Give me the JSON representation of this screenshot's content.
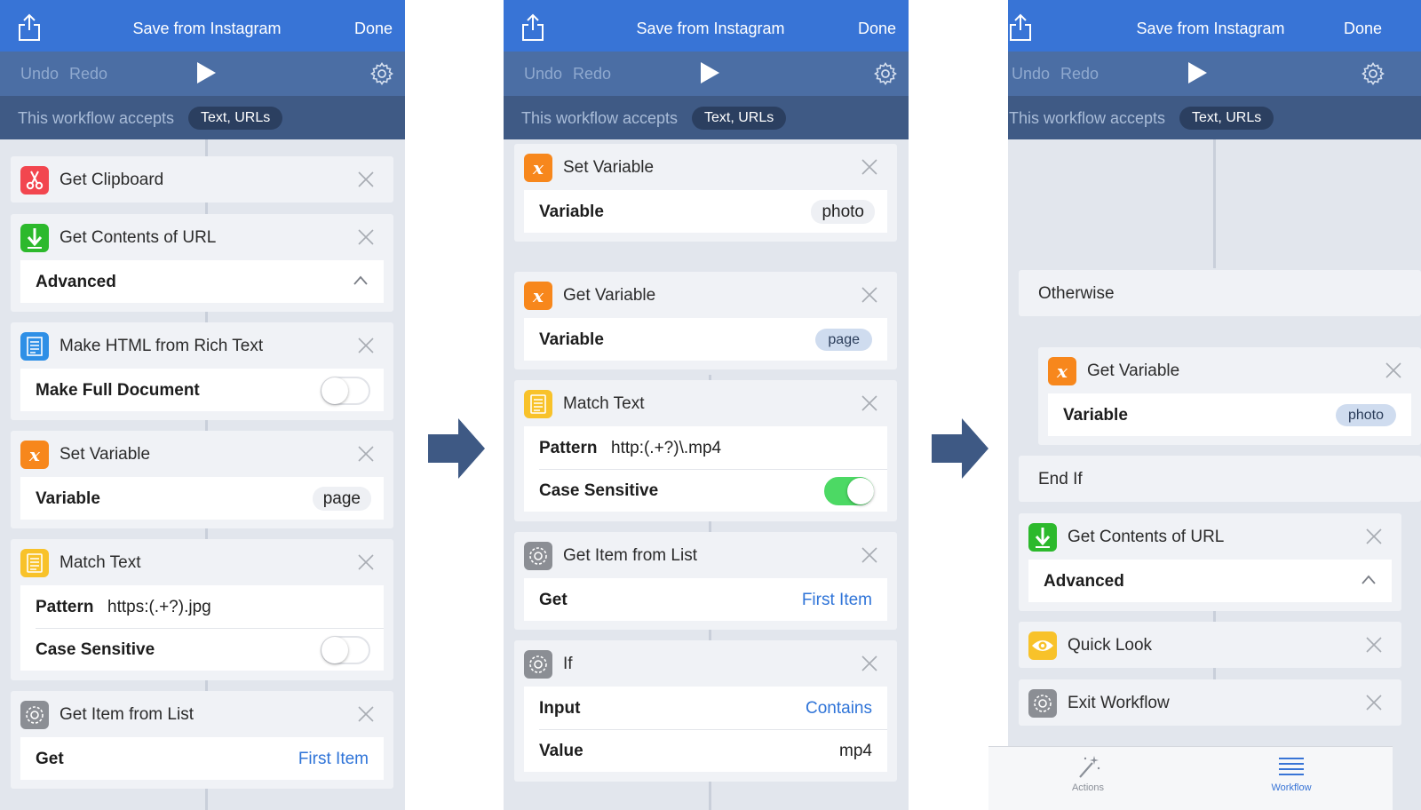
{
  "nav": {
    "title": "Save from Instagram",
    "done": "Done"
  },
  "toolbar": {
    "undo": "Undo",
    "redo": "Redo"
  },
  "accepts": {
    "label": "This workflow accepts",
    "types": "Text, URLs"
  },
  "panel1": {
    "get_clipboard": "Get Clipboard",
    "get_contents": "Get Contents of URL",
    "advanced": "Advanced",
    "make_html": "Make HTML from Rich Text",
    "make_full_document": "Make Full Document",
    "make_full_document_on": false,
    "set_variable": "Set Variable",
    "variable_label": "Variable",
    "variable_value": "page",
    "match_text": "Match Text",
    "pattern_label": "Pattern",
    "pattern_value": "https:(.+?).jpg",
    "case_sensitive": "Case Sensitive",
    "case_sensitive_on": false,
    "get_item": "Get Item from List",
    "get_label": "Get",
    "get_value": "First Item"
  },
  "panel2": {
    "set_variable": "Set Variable",
    "variable_label": "Variable",
    "set_variable_value": "photo",
    "get_variable": "Get Variable",
    "get_variable_token": "page",
    "match_text": "Match Text",
    "pattern_label": "Pattern",
    "pattern_value": "http:(.+?)\\.mp4",
    "case_sensitive": "Case Sensitive",
    "case_sensitive_on": true,
    "get_item": "Get Item from List",
    "get_label": "Get",
    "get_value": "First Item",
    "if_title": "If",
    "input_label": "Input",
    "input_value": "Contains",
    "value_label": "Value",
    "value_value": "mp4"
  },
  "panel3": {
    "otherwise": "Otherwise",
    "get_variable": "Get Variable",
    "variable_label": "Variable",
    "variable_token": "photo",
    "end_if": "End If",
    "get_contents": "Get Contents of URL",
    "advanced": "Advanced",
    "quick_look": "Quick Look",
    "exit_workflow": "Exit Workflow"
  },
  "tabs": {
    "actions": "Actions",
    "workflow": "Workflow"
  },
  "colors": {
    "nav_blue": "#3874d6",
    "toolbar": "#4b6ea4",
    "accepts_bar": "#3f5a85",
    "variable_orange": "#f7871c",
    "clipboard_red": "#f2464f",
    "download_green": "#2cb92c",
    "html_blue": "#2e8fe6",
    "text_yellow": "#f8c22a",
    "gear_gray": "#8b8e94",
    "toggle_green": "#4cd964",
    "link_blue": "#2f74d8"
  },
  "icons": [
    "share-icon",
    "play-icon",
    "gear-icon",
    "scissors-icon",
    "download-arrow-icon",
    "document-icon",
    "variable-x-icon",
    "text-lines-icon",
    "cog-icon",
    "eye-icon",
    "close-icon",
    "chevron-up-icon",
    "right-arrow-icon",
    "magic-wand-icon",
    "list-icon"
  ]
}
